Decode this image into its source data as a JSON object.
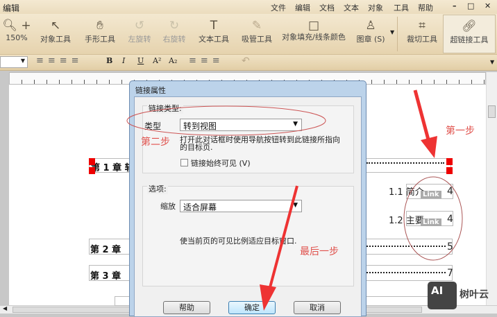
{
  "app": {
    "title": "编辑"
  },
  "menu": [
    "文件",
    "编辑",
    "文档",
    "文本",
    "对象",
    "工具",
    "帮助"
  ],
  "window_buttons": {
    "minimize": "–",
    "maximize": "□",
    "close": "✕"
  },
  "toolbar": {
    "zoom": "150%",
    "items": [
      "对象工具",
      "手形工具",
      "左旋转",
      "右旋转",
      "文本工具",
      "吸管工具",
      "对象填充/线条颜色",
      "图章 (S)",
      "裁切工具",
      "超链接工具"
    ]
  },
  "document": {
    "toc": [
      {
        "label": "第 1 章  软",
        "page": ""
      },
      {
        "label": "1.1 简介",
        "page": "4",
        "link": "Link"
      },
      {
        "label": "1.2 主要",
        "page": "4",
        "link": "Link"
      },
      {
        "label": "第 2 章",
        "page": "5"
      },
      {
        "label": "第 3 章",
        "page": "7"
      }
    ]
  },
  "dialog": {
    "title": "链接属性",
    "group1": "链接类型:",
    "type_label": "类型",
    "type_value": "转到视图",
    "type_desc": "打开此对话框时使用导航按钮转到此链接所指向的目标页.",
    "always_visible": "链接始终可见  (V)",
    "group2": "选项:",
    "zoom_label": "缩放",
    "zoom_value": "适合屏幕",
    "zoom_desc": "使当前页的可见比例适应目标窗口.",
    "help": "帮助",
    "ok": "确定",
    "cancel": "取消"
  },
  "annotations": {
    "step1": "第一步",
    "step2": "第二步",
    "last": "最后一步",
    "color": "#e0514c"
  },
  "watermark": {
    "logo": "AI",
    "text": "树叶云"
  }
}
